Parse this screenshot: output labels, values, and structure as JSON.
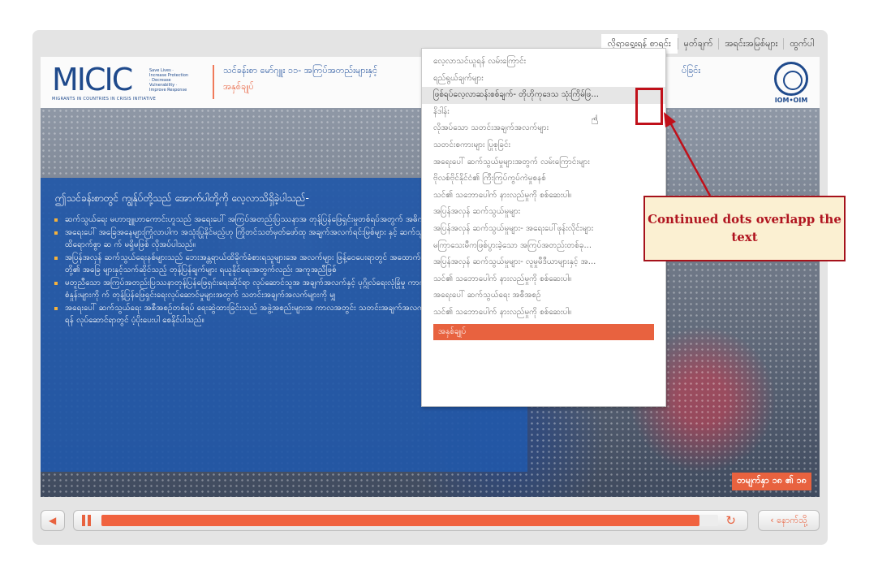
{
  "topnav": [
    "လိုရာရွေးရန် စာရင်း",
    "မှတ်ချက်",
    "အရင်းအမြစ်များ",
    "ထွက်ပါ"
  ],
  "header": {
    "logo_text": "MICIC",
    "logo_tagline": "Save Lives · Increase Protection · Decrease Vulnerability · Improve Response",
    "logo_sub": "MIGRANTS IN COUNTRIES IN CRISIS INITIATIVE",
    "title_line1": "သင်ခန်းစာ မော်ဂျူး ၁၁- အကြပ်အတည်းများနှင့်",
    "title_line1_end": "ပ်ခြင်း",
    "title_line2": "အနှစ်ချုပ်",
    "iom_label": "IOM•OIM"
  },
  "content": {
    "intro": "ဤသင်ခန်းစာတွင် ကျွန်ုပ်တို့သည် အောက်ပါတို့ကို လေ့လာသိရှိခဲ့ပါသည်-",
    "bullets": [
      "ဆက်သွယ်ရေး မဟာဗျူဟာကောင်းဟူသည် အရေးပေါ် အကြပ်အတည်းပြဿနာအ တုန့်ပြန်ဖြေရှင်းမှုတစ်ရပ်အတွက် အဓိကသော့ချက်တစ်ရပ်ဖြစ်သည်။",
      "အရေးပေါ် အခြေအနေများကြုံလာပါက အသုံးပြုနိုင်မည့်ဟု ကြိုတင်သတ်မှတ်ဖော်ထု အချက်အလက်ရင်းမြစ်များ နှင့် ဆက်သွယ်ရေးနည်းလမ်းများသည် ထိရောက်စွာ ဆ က် မရှိမဖြစ် လိုအပ်ပါသည်။",
      "အပြန်အလှန် ဆက်သွယ်ရေးနစ်များသည် ဘေးအန္တရာယ်ထိခိုက်ခံစားရသူများအေ အလက်များ ဖြန့်ဝေပေးရာတွင် အထောက်အကူဖြစ်စေသည့်အပြင် ၎င်းတို့၏ အခြေ များနှင့်သက်ဆိုင်သည့် တုန့်ပြန်ချက်များ ရယူနိုင်ရေးအတွက်လည်း အကူအညီဖြစ်",
      "မတူညီသော အကြပ်အတည်းပြဿနာတုန့်ပြန်ဖြေရှင်းရေးဆိုင်ရာ လုပ်ဆောင်သူအ အချက်အလက်နှင့် ပုဂ္ဂိုလ်ရေးလုံခြုံမှု ကာကွယ်စောင့်ရှောက်ရေးဆိုင်ရာစံနှုန်းများကို က် တုန့်ပြန်ဖြေရှင်းရေးလုပ်ဆောင်မှုများအတွက် သတင်းအချက်အလက်များကို မျှ",
      "အရေးပေါ် ဆက်သွယ်ရေး အစီအစဉ်တစ်ရပ် ရေးဆွဲထားခြင်းသည် အဖွဲ့အစည်းများအ ကာလအတွင်း သတင်းအချက်အလက်များ စုဆောင်းရန်နှင့် ဖြန့်ဝေရန် လုပ်ဆောင်ရာတွင် ပံ့ပိုးပေးပါ စေနိုင်ပါသည်။"
    ]
  },
  "menu": {
    "items": [
      "လေ့လာသင်ယူရန် လမ်းကြောင်း",
      "ရည်ရွယ်ချက်များ",
      "ဖြစ်ရပ်လေ့လာဆန်းစစ်ချက်- တိုဟိုကုဒေသ သုံးကြိမ်ဖြ...",
      "နိဒါန်း",
      "လိုအပ်သော သတင်းအချက်အလက်များ",
      "သတင်းစကားများ ပြုစုခြင်း",
      "အရေးပေါ် ဆက်သွယ်မှုများအတွက် လမ်းကြောင်းများ",
      "ဗိုလစ်ဗိုင်နိုင်ငံ၏ ကြီးကြပ်ကွပ်ကဲမှုစနစ်",
      "သင်၏ သဘောပေါက် နားလည်မှုကို စစ်ဆေးပါ။",
      "အပြန်အလှန် ဆက်သွယ်မှုများ",
      "အပြန်အလှန် ဆက်သွယ်မှုများ- အရေးပေါ်ဖုန်းလိုင်းများ",
      "မကြာသေးမီကဖြစ်ပွားခဲ့သော အကြပ်အတည်းတစ်ခု...",
      "အပြန်အလှန် ဆက်သွယ်မှုများ- လူမှုမီဒီယာများနှင့် အ...",
      "သင်၏ သဘောပေါက် နားလည်မှုကို စစ်ဆေးပါ။",
      "အရေးပေါ် ဆက်သွယ်ရေး အစီအစဉ်",
      "သင်၏ သဘောပေါက် နားလည်မှုကို စစ်ဆေးပါ။"
    ],
    "active": "အနှစ်ချုပ်"
  },
  "slide_counter": "တမျက်နှာ ၁၈ ၏ ၁၈",
  "annotation": {
    "callout": "Continued dots overlapp the text",
    "color": "#c0101a"
  },
  "player": {
    "progress": 0.97,
    "back_label": "‹ နောက်သို့",
    "accent": "#e8623f"
  }
}
